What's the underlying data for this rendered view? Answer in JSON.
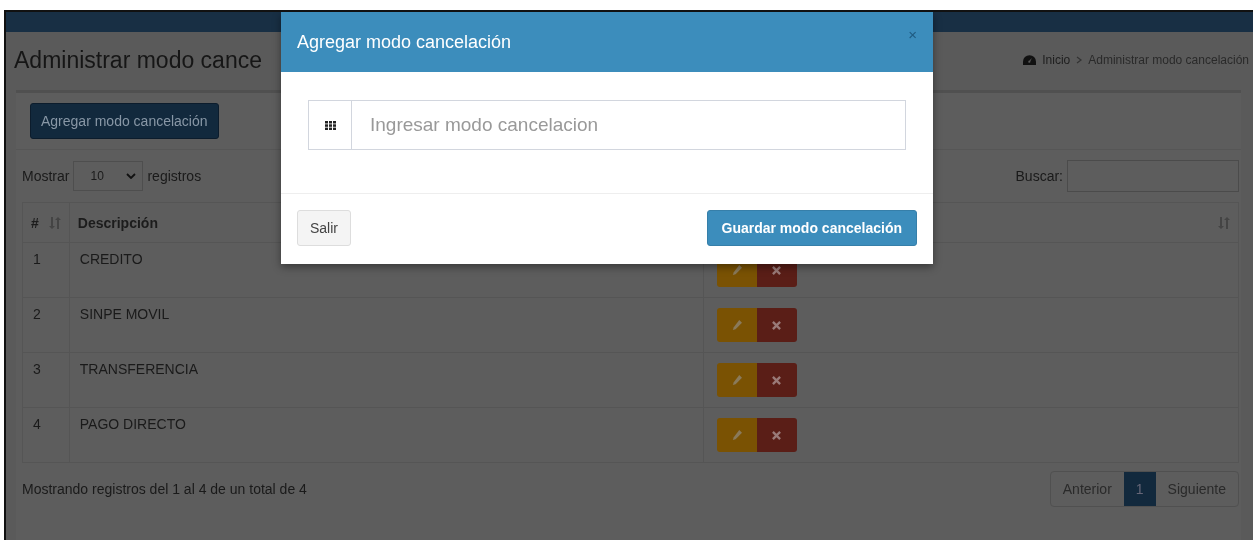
{
  "page": {
    "title": "Administrar modo cance",
    "breadcrumb": [
      {
        "label": "Inicio"
      },
      {
        "label": "Administrar modo cancelación"
      }
    ]
  },
  "toolbar": {
    "add_button": "Agregar modo cancelación"
  },
  "length_control": {
    "prefix": "Mostrar",
    "value": "10",
    "suffix": "registros"
  },
  "search": {
    "label": "Buscar:"
  },
  "table": {
    "columns": [
      {
        "label": "#",
        "sort_icon": true
      },
      {
        "label": "Descripción",
        "sort_icon": false
      },
      {
        "sort_icon": true
      }
    ],
    "rows": [
      {
        "number": "1",
        "description": "CREDITO"
      },
      {
        "number": "2",
        "description": "SINPE MOVIL"
      },
      {
        "number": "3",
        "description": "TRANSFERENCIA"
      },
      {
        "number": "4",
        "description": "PAGO DIRECTO"
      }
    ]
  },
  "info": "Mostrando registros del 1 al 4 de un total de 4",
  "pagination": [
    {
      "label": "Anterior",
      "selected": false
    },
    {
      "label": "1",
      "selected": true
    },
    {
      "label": "Siguiente",
      "selected": false
    }
  ],
  "modal": {
    "title": "Agregar modo cancelación",
    "close": "×",
    "placeholder": "Ingresar modo cancelacion",
    "cancel": "Salir",
    "save": "Guardar modo cancelación"
  }
}
